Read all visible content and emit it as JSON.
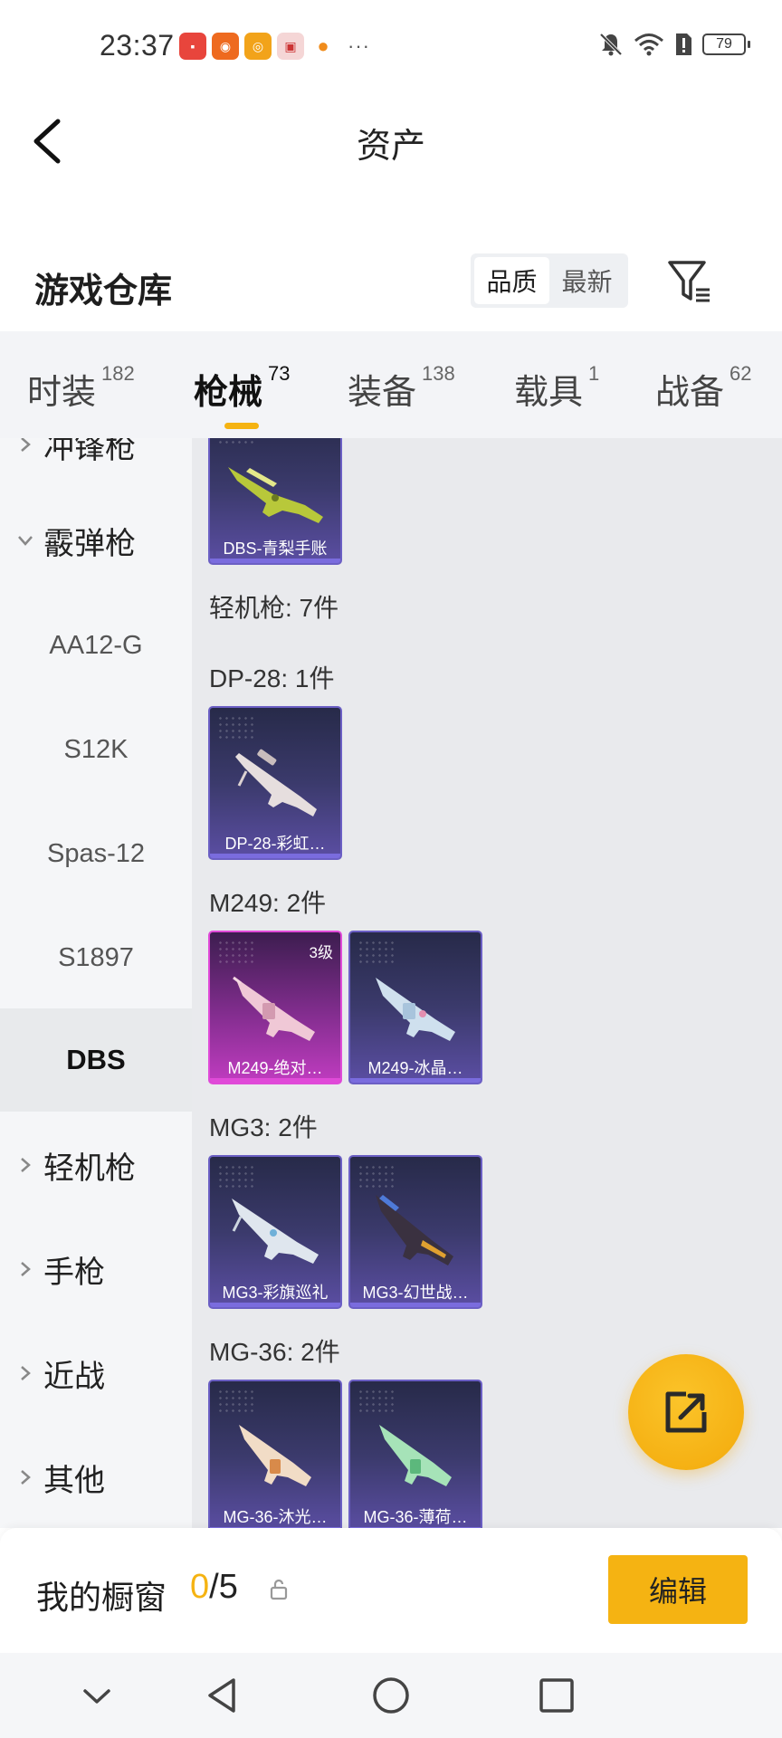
{
  "status_bar": {
    "time": "23:37",
    "more": "···",
    "battery": "79"
  },
  "header": {
    "title": "资产"
  },
  "section": {
    "title": "游戏仓库",
    "sort_options": [
      "品质",
      "最新"
    ],
    "active_sort": "品质"
  },
  "categories": [
    {
      "label": "时装",
      "count": "182"
    },
    {
      "label": "枪械",
      "count": "73"
    },
    {
      "label": "装备",
      "count": "138"
    },
    {
      "label": "载具",
      "count": "1"
    },
    {
      "label": "战备",
      "count": "62"
    }
  ],
  "active_category": "枪械",
  "sidebar": {
    "cut_top": "冲锋枪",
    "group_shotgun": "霰弹枪",
    "shotgun_items": [
      "AA12-G",
      "S12K",
      "Spas-12",
      "S1897",
      "DBS"
    ],
    "selected": "DBS",
    "groups_below": [
      "轻机枪",
      "手枪",
      "近战",
      "其他"
    ]
  },
  "content": {
    "top_card": {
      "label": "DBS-青梨手账"
    },
    "lmg_header": "轻机枪: 7件",
    "groups": [
      {
        "header": "DP-28: 1件",
        "cards": [
          {
            "label": "DP-28-彩虹…"
          }
        ]
      },
      {
        "header": "M249: 2件",
        "cards": [
          {
            "label": "M249-绝对…",
            "level": "3级"
          },
          {
            "label": "M249-冰晶…"
          }
        ]
      },
      {
        "header": "MG3: 2件",
        "cards": [
          {
            "label": "MG3-彩旗巡礼"
          },
          {
            "label": "MG3-幻世战…"
          }
        ]
      },
      {
        "header": "MG-36: 2件",
        "cards": [
          {
            "label": "MG-36-沐光…"
          },
          {
            "label": "MG-36-薄荷…"
          }
        ]
      }
    ]
  },
  "showcase": {
    "title": "我的橱窗",
    "current": "0",
    "total": "/5",
    "edit_label": "编辑"
  },
  "colors": {
    "accent": "#f5b312",
    "card_purple": "#5b4ea3",
    "card_pink": "#c03cc0"
  }
}
